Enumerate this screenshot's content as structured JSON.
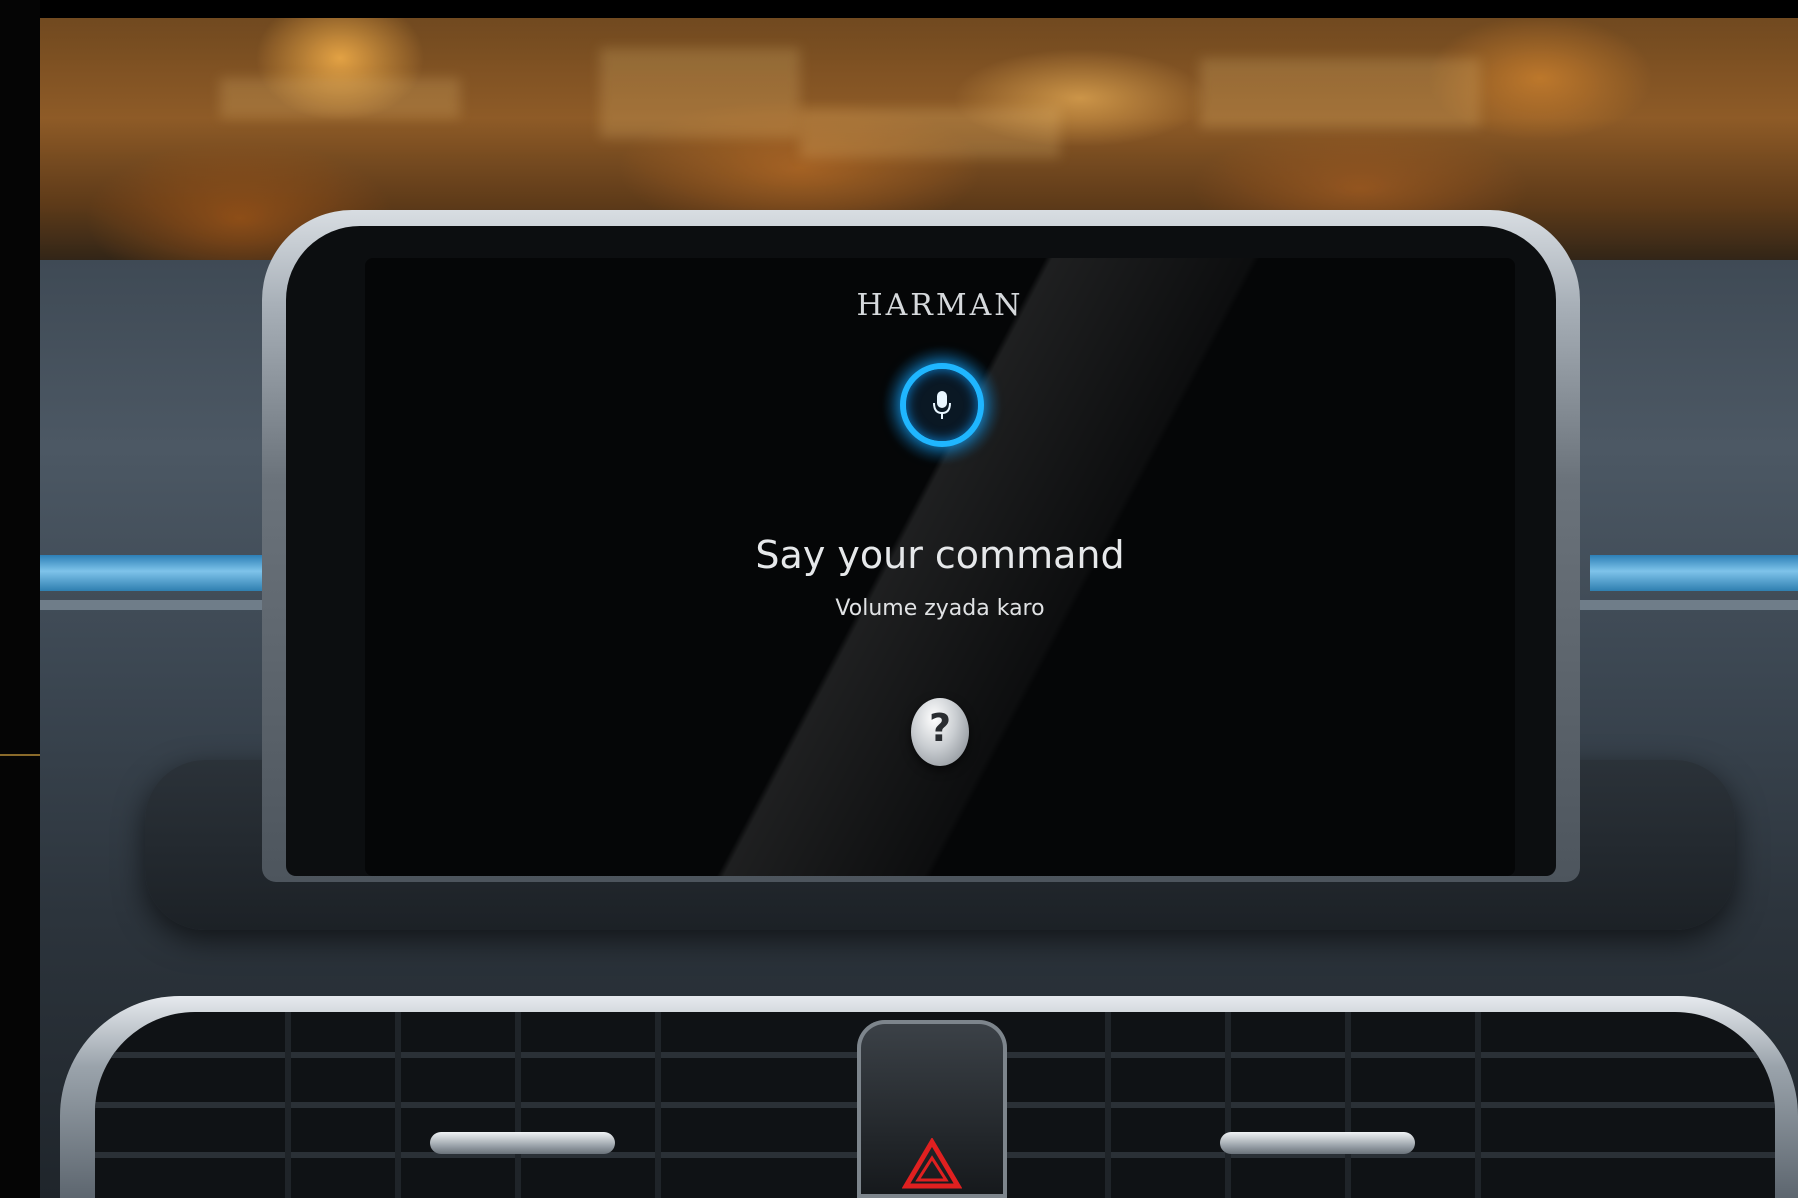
{
  "display": {
    "brand": "HARMAN",
    "voice_prompt": {
      "title": "Say your command",
      "example": "Volume zyada karo"
    },
    "mic_icon": "microphone-icon",
    "help_icon": "question-mark-icon",
    "help_label": "?",
    "accent_color": "#1fb6ff"
  },
  "dashboard": {
    "hazard_icon": "hazard-triangle-icon",
    "hazard_color": "#e02020"
  }
}
